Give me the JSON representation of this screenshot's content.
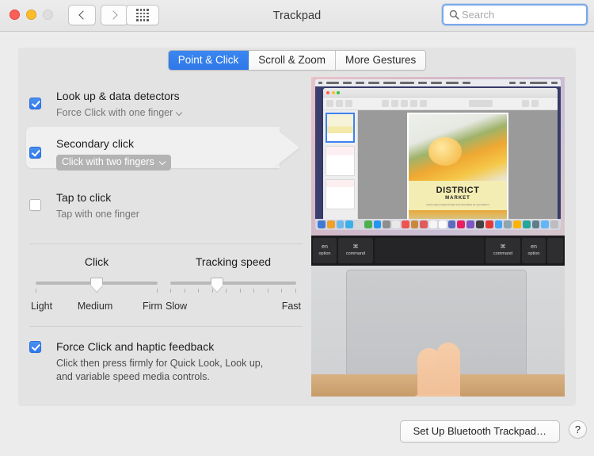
{
  "window": {
    "title": "Trackpad",
    "traffic_lights": [
      "close",
      "minimize",
      "zoom-disabled"
    ],
    "nav_back": "back-icon",
    "nav_forward": "forward-icon",
    "grid_button": "show-all-icon"
  },
  "search": {
    "placeholder": "Search",
    "value": "",
    "icon": "search-icon"
  },
  "tabs": [
    {
      "label": "Point & Click",
      "active": true
    },
    {
      "label": "Scroll & Zoom",
      "active": false
    },
    {
      "label": "More Gestures",
      "active": false
    }
  ],
  "options": [
    {
      "title": "Look up & data detectors",
      "sub": "Force Click with one finger",
      "checked": true,
      "style": "plain",
      "chevron": "chevron-down-icon"
    },
    {
      "title": "Secondary click",
      "sub": "Click with two fingers",
      "checked": true,
      "style": "popup",
      "chevron": "chevron-down-icon",
      "highlighted": true
    },
    {
      "title": "Tap to click",
      "sub": "Tap with one finger",
      "checked": false,
      "style": "plain",
      "chevron": ""
    }
  ],
  "sliders": [
    {
      "title": "Click",
      "labels": [
        "Light",
        "Medium",
        "Firm"
      ],
      "ticks": 3,
      "value_percent": 50
    },
    {
      "title": "Tracking speed",
      "labels": [
        "Slow",
        "Fast"
      ],
      "ticks": 10,
      "value_percent": 37
    }
  ],
  "force_click": {
    "title": "Force Click and haptic feedback",
    "sub_line1": "Click then press firmly for Quick Look, Look up,",
    "sub_line2": "and variable speed media controls.",
    "checked": true
  },
  "footer": {
    "setup_button": "Set Up Bluetooth Trackpad…",
    "help_button": "?"
  },
  "video": {
    "doc_title": "DISTRICT",
    "doc_subtitle": "MARKET",
    "doc_tagline": "Home-style prepared foods and necessities for your kitchen",
    "keys": [
      {
        "glyph": "en",
        "label": "option"
      },
      {
        "glyph": "⌘",
        "label": "command"
      },
      {
        "glyph": "",
        "label": ""
      },
      {
        "glyph": "⌘",
        "label": "command"
      },
      {
        "glyph": "en",
        "label": "option"
      }
    ]
  },
  "colors": {
    "accent": "#2f77e8",
    "checkbox_on": "#2d7af0",
    "panel": "#e3e3e3",
    "window": "#ececec",
    "highlight": "#f0f0f0"
  }
}
